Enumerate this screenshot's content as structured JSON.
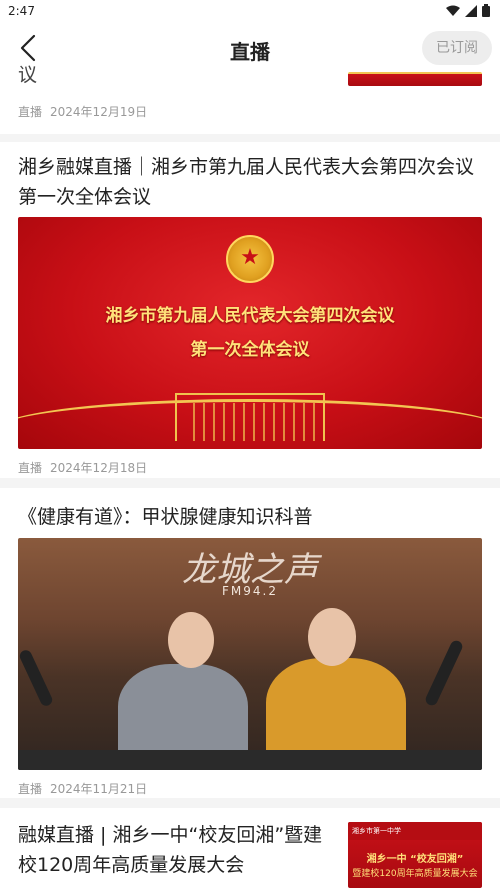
{
  "status_bar": {
    "time": "2:47"
  },
  "header": {
    "title": "直播",
    "subscribe_label": "已订阅"
  },
  "cards": [
    {
      "title_fragment": "议",
      "type_label": "直播",
      "date": "2024年12月19日"
    },
    {
      "title": "湘乡融媒直播｜湘乡市第九届人民代表大会第四次会议第一次全体会议",
      "image_text_1": "湘乡市第九届人民代表大会第四次会议",
      "image_text_2": "第一次全体会议",
      "type_label": "直播",
      "date": "2024年12月18日"
    },
    {
      "title": "《健康有道》：甲状腺健康知识科普",
      "image_logo": "龙城之声",
      "image_fm": "FM94.2",
      "type_label": "直播",
      "date": "2024年11月21日"
    },
    {
      "title": "融媒直播 | 湘乡一中“校友回湘”暨建校120周年高质量发展大会",
      "thumb_top": "湘乡市第一中学",
      "thumb_line1": "湘乡一中 “校友回湘”",
      "thumb_line2": "暨建校120周年高质量发展大会"
    }
  ],
  "colors": {
    "accent_red": "#c80f16",
    "gold": "#ffe27a",
    "meta_gray": "#999999"
  },
  "icons": [
    "wifi-icon",
    "signal-icon",
    "battery-icon",
    "back-arrow-icon"
  ]
}
